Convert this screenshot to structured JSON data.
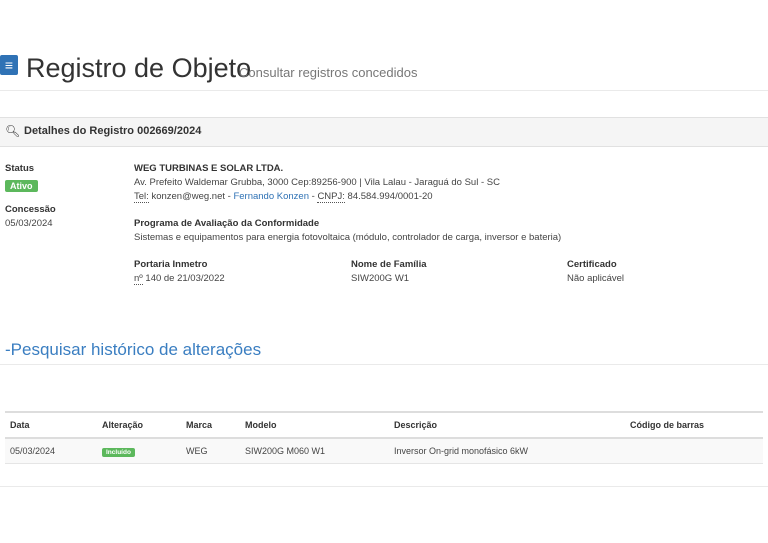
{
  "header": {
    "menu_icon": "hamburger-icon",
    "title": "Registro de Objeto",
    "subtitle": "Consultar registros concedidos"
  },
  "details": {
    "search_icon": "search-icon",
    "heading": "Detalhes do Registro 002669/2024",
    "status_label": "Status",
    "status_value": "Ativo",
    "concession_label": "Concessão",
    "concession_value": "05/03/2024",
    "company_name": "WEG TURBINAS E SOLAR LTDA.",
    "address": "Av. Prefeito Waldemar Grubba, 3000 Cep:89256-900 | Vila Lalau - Jaraguá do Sul - SC",
    "tel_label": "Tel:",
    "email": "konzen@weg.net",
    "sep1": " - ",
    "contact_name": "Fernando Konzen",
    "sep2": " - ",
    "cnpj_label": "CNPJ:",
    "cnpj_value": "84.584.994/0001-20",
    "program_label": "Programa de Avaliação da Conformidade",
    "program_value": "Sistemas e equipamentos para energia fotovoltaica (módulo, controlador de carga, inversor e bateria)",
    "portaria_label": "Portaria Inmetro",
    "portaria_no": "nº",
    "portaria_value": "140 de 21/03/2022",
    "family_label": "Nome de Família",
    "family_value": "SIW200G W1",
    "cert_label": "Certificado",
    "cert_value": "Não aplicável",
    "accent_color": "#5cb85c"
  },
  "history": {
    "title": "-Pesquisar histórico de alterações",
    "columns": [
      "Data",
      "Alteração",
      "Marca",
      "Modelo",
      "Descrição",
      "Código de barras"
    ],
    "rows": [
      {
        "data": "05/03/2024",
        "alteracao": "Incluído",
        "marca": "WEG",
        "modelo": "SIW200G M060 W1",
        "descricao": "Inversor On-grid monofásico 6kW",
        "codigo": ""
      }
    ]
  }
}
